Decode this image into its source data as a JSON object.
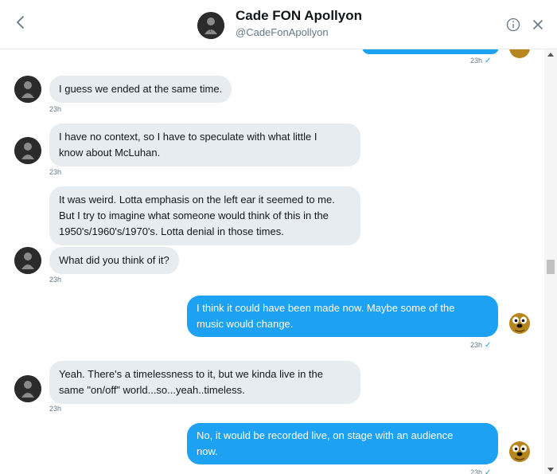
{
  "header": {
    "name": "Cade FON Apollyon",
    "handle": "@CadeFonApollyon",
    "back_icon": "chevron-left-icon",
    "info_icon": "info-icon",
    "close_icon": "close-icon"
  },
  "colors": {
    "accent": "#1da1f2",
    "incoming_bubble": "#e6ecf0",
    "muted_text": "#657786"
  },
  "messages": {
    "m0_time": "23h",
    "m1": "I guess we ended at the same time.",
    "m1_time": "23h",
    "m2_line1": "I have no context, so I have to speculate with what little I",
    "m2_line2": "know about McLuhan.",
    "m2_time": "23h",
    "m3_line1": "It was weird. Lotta emphasis on the left ear it seemed to me.",
    "m3_line2": "But I try to imagine what someone would think of this in the",
    "m3_line3": "1950's/1960's/1970's. Lotta denial in those times.",
    "m4": "What did you think of it?",
    "m4_time": "23h",
    "m5_line1": "I think it could have been made now. Maybe some of the",
    "m5_line2": "music would change.",
    "m5_time": "23h",
    "m6_line1": "Yeah. There's a timelessness to it, but we kinda live in the",
    "m6_line2": "same \"on/off\" world...so...yeah..timeless.",
    "m6_time": "23h",
    "m7_line1": "No, it would be recorded live, on stage with an audience",
    "m7_line2": "now.",
    "m7_time": "23h"
  }
}
